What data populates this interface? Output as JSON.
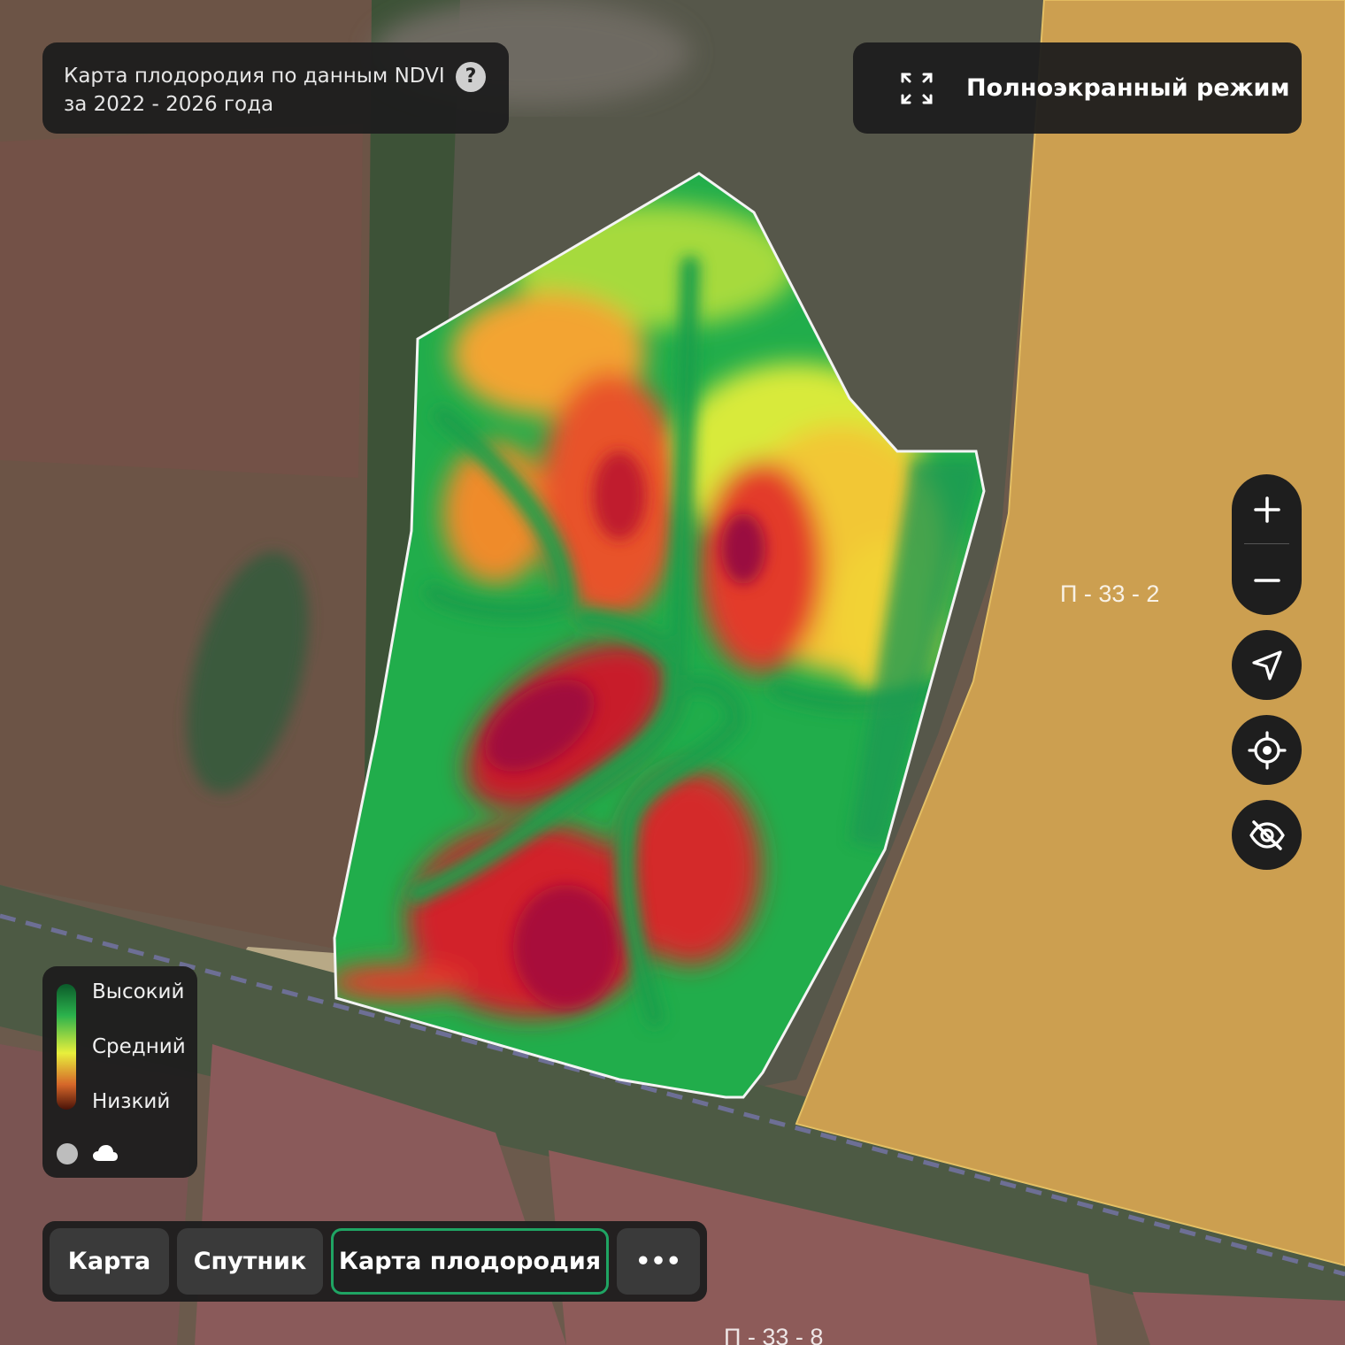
{
  "info": {
    "line1": "Карта плодородия по данным NDVI",
    "line2": "за 2022 - 2026 года",
    "help": "?"
  },
  "fullscreen": {
    "label": "Полноэкранный режим"
  },
  "map": {
    "field_labels": [
      "П - 33 - 2",
      "П - 33 - 8"
    ],
    "controls": {
      "zoom_in": "+",
      "zoom_out": "−"
    }
  },
  "legend": {
    "high": "Высокий",
    "mid": "Средний",
    "low": "Низкий"
  },
  "tabs": [
    {
      "label": "Карта"
    },
    {
      "label": "Спутник"
    },
    {
      "label": "Карта плодородия",
      "active": true
    },
    {
      "label": "•••"
    }
  ],
  "colors": {
    "accent": "#1fa463",
    "panel": "#1e1e1e",
    "ndvi_high": "#0b8a4c",
    "ndvi_low": "#b0102c"
  }
}
